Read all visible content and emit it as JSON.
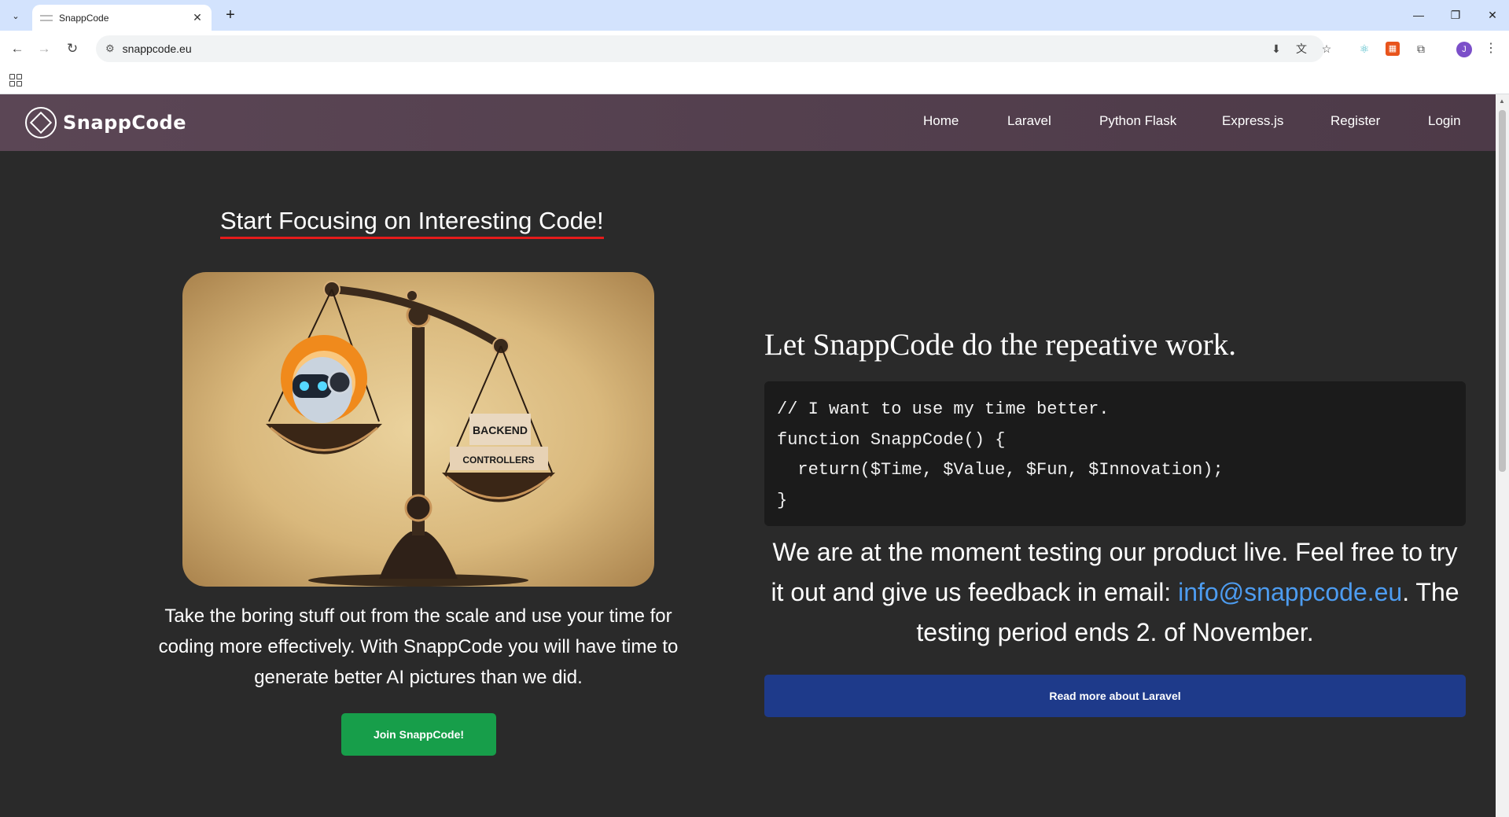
{
  "browser": {
    "tab_title": "SnappCode",
    "url": "snappcode.eu",
    "new_tab": "+",
    "tab_close": "✕",
    "avatar_initial": "J"
  },
  "site": {
    "brand_name": "SnappCode",
    "nav": [
      "Home",
      "Laravel",
      "Python Flask",
      "Express.js",
      "Register",
      "Login"
    ]
  },
  "hero": {
    "title": "Start Focusing on Interesting Code!",
    "image_labels": [
      "BACKEND",
      "CONTROLLERS"
    ],
    "text": "Take the boring stuff out from the scale and use your time for coding more effectively. With SnappCode you will have time to generate better AI pictures than we did.",
    "cta": "Join SnappCode!"
  },
  "right": {
    "heading": "Let SnappCode do the repeative work.",
    "code_lines": [
      "// I want to use my time better.",
      "function SnappCode() {",
      "  return($Time, $Value, $Fun, $Innovation);",
      "}"
    ],
    "info_before": "We are at the moment testing our product live. Feel free to try it out and give us feedback in email: ",
    "info_email": "info@snappcode.eu",
    "info_after": ". The testing period ends 2. of November.",
    "button": "Read more about Laravel"
  },
  "colors": {
    "nav_bg": "#5b4655",
    "page_bg": "#2a2a2a",
    "title_underline": "#e51b1b",
    "join_button": "#179e4a",
    "laravel_button": "#1e3a8a",
    "email_link": "#4d9cf0"
  }
}
